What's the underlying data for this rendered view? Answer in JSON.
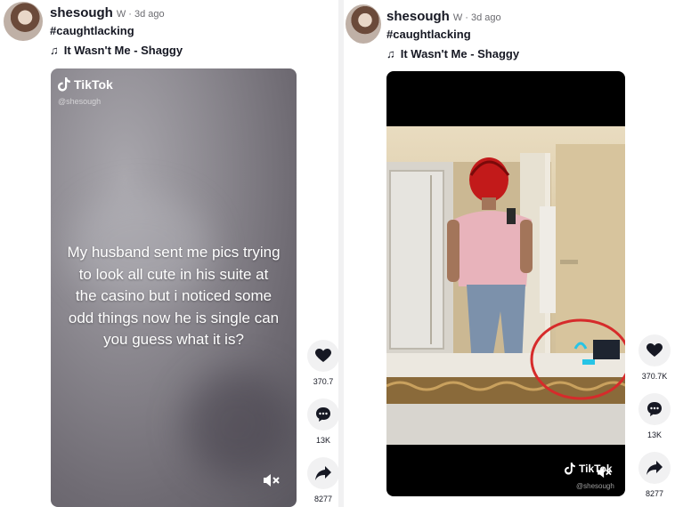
{
  "posts": [
    {
      "author": "shesough",
      "meta": "W · 3d ago",
      "hashtag": "#caughtlacking",
      "music": "It Wasn't Me - Shaggy",
      "watermark": {
        "brand": "TikTok",
        "handle": "@shesough"
      },
      "caption": "My husband sent me pics trying to look all cute in his suite at the casino but i noticed some odd things now he is single can you guess what it is?",
      "stats": {
        "likes": "370.7",
        "comments": "13K",
        "shares": "8277"
      }
    },
    {
      "author": "shesough",
      "meta": "W · 3d ago",
      "hashtag": "#caughtlacking",
      "music": "It Wasn't Me - Shaggy",
      "watermark": {
        "brand": "TikTok",
        "handle": "@shesough"
      },
      "stats": {
        "likes": "370.7K",
        "comments": "13K",
        "shares": "8277"
      }
    }
  ],
  "colors": {
    "highlight_circle": "#d62b2b",
    "icon": "#161823",
    "button_bg": "#f1f1f2"
  },
  "icons": [
    "music-note-icon",
    "tiktok-logo-icon",
    "heart-icon",
    "comment-icon",
    "share-icon",
    "mute-icon"
  ]
}
